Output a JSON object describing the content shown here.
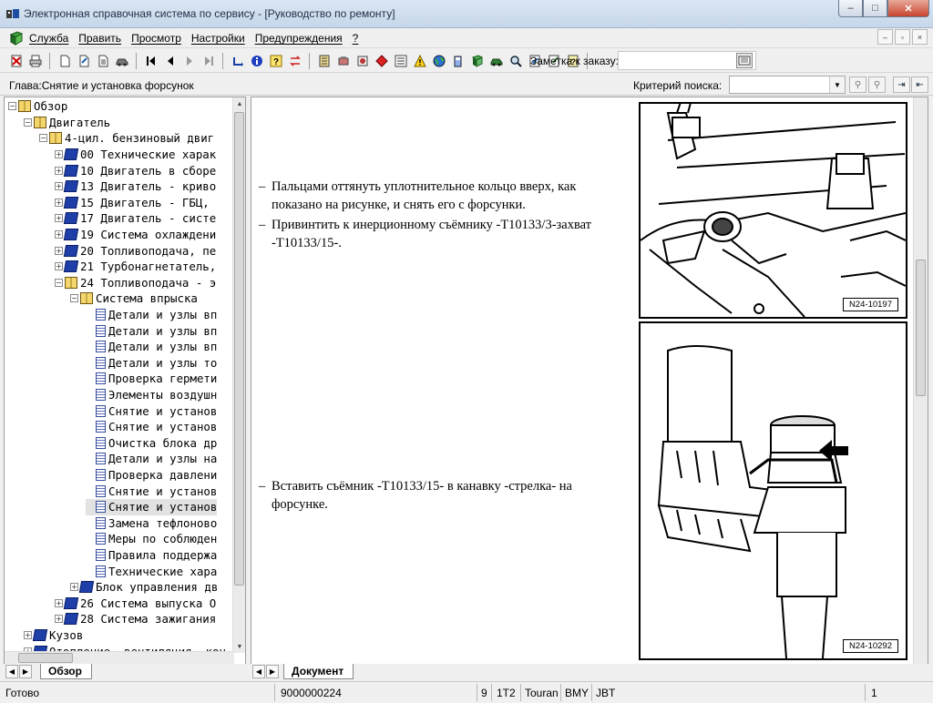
{
  "window": {
    "title": "Электронная справочная система по сервису - [Руководство по ремонту]",
    "minimize": "‒",
    "maximize": "□",
    "close": "✕"
  },
  "menu": {
    "items": [
      "Служба",
      "Править",
      "Просмотр",
      "Настройки",
      "Предупреждения",
      "?"
    ],
    "mdi": [
      "–",
      "▫",
      "×"
    ]
  },
  "toolbar": {
    "note_label": "Заметка к заказу:",
    "note_value": ""
  },
  "chapter": {
    "label": "Глава:Снятие и установка форсунок",
    "criteria_label": "Критерий поиска:",
    "criteria_value": ""
  },
  "tree": {
    "nodes": [
      {
        "level": 0,
        "expander": "−",
        "icon": "book-open",
        "text": "Обзор"
      },
      {
        "level": 1,
        "expander": "−",
        "icon": "book-open",
        "text": "Двигатель"
      },
      {
        "level": 2,
        "expander": "−",
        "icon": "book-open",
        "text": "4-цил. бензиновый двиг"
      },
      {
        "level": 3,
        "expander": "+",
        "icon": "book-closed",
        "text": "00 Технические харак"
      },
      {
        "level": 3,
        "expander": "+",
        "icon": "book-closed",
        "text": "10 Двигатель в сборе"
      },
      {
        "level": 3,
        "expander": "+",
        "icon": "book-closed",
        "text": "13 Двигатель - криво"
      },
      {
        "level": 3,
        "expander": "+",
        "icon": "book-closed",
        "text": "15 Двигатель - ГБЦ,"
      },
      {
        "level": 3,
        "expander": "+",
        "icon": "book-closed",
        "text": "17 Двигатель - систе"
      },
      {
        "level": 3,
        "expander": "+",
        "icon": "book-closed",
        "text": "19 Система охлаждени"
      },
      {
        "level": 3,
        "expander": "+",
        "icon": "book-closed",
        "text": "20 Топливоподача, пе"
      },
      {
        "level": 3,
        "expander": "+",
        "icon": "book-closed",
        "text": "21 Турбонагнетатель,"
      },
      {
        "level": 3,
        "expander": "−",
        "icon": "book-open",
        "text": "24 Топливоподача - э"
      },
      {
        "level": 4,
        "expander": "−",
        "icon": "book-open",
        "text": "Система впрыска"
      },
      {
        "level": 5,
        "expander": "",
        "icon": "doc",
        "text": "Детали и узлы вп"
      },
      {
        "level": 5,
        "expander": "",
        "icon": "doc",
        "text": "Детали и узлы вп"
      },
      {
        "level": 5,
        "expander": "",
        "icon": "doc",
        "text": "Детали и узлы вп"
      },
      {
        "level": 5,
        "expander": "",
        "icon": "doc",
        "text": "Детали и узлы то"
      },
      {
        "level": 5,
        "expander": "",
        "icon": "doc",
        "text": "Проверка гермети"
      },
      {
        "level": 5,
        "expander": "",
        "icon": "doc",
        "text": "Элементы воздушн"
      },
      {
        "level": 5,
        "expander": "",
        "icon": "doc",
        "text": "Снятие и установ"
      },
      {
        "level": 5,
        "expander": "",
        "icon": "doc",
        "text": "Снятие и установ"
      },
      {
        "level": 5,
        "expander": "",
        "icon": "doc",
        "text": "Очистка блока др"
      },
      {
        "level": 5,
        "expander": "",
        "icon": "doc",
        "text": "Детали и узлы на"
      },
      {
        "level": 5,
        "expander": "",
        "icon": "doc",
        "text": "Проверка давлени"
      },
      {
        "level": 5,
        "expander": "",
        "icon": "doc",
        "text": "Снятие и установ"
      },
      {
        "level": 5,
        "expander": "",
        "icon": "doc",
        "text": "Снятие и установ"
      },
      {
        "level": 5,
        "expander": "",
        "icon": "doc",
        "text": "Замена тефлоново"
      },
      {
        "level": 5,
        "expander": "",
        "icon": "doc",
        "text": "Меры по соблюден"
      },
      {
        "level": 5,
        "expander": "",
        "icon": "doc",
        "text": "Правила поддержа"
      },
      {
        "level": 5,
        "expander": "",
        "icon": "doc",
        "text": "Технические хара"
      },
      {
        "level": 4,
        "expander": "+",
        "icon": "book-closed",
        "text": "Блок управления дв"
      },
      {
        "level": 3,
        "expander": "+",
        "icon": "book-closed",
        "text": "26 Система выпуска О"
      },
      {
        "level": 3,
        "expander": "+",
        "icon": "book-closed",
        "text": "28 Система зажигания"
      },
      {
        "level": 1,
        "expander": "+",
        "icon": "book-closed",
        "text": "Кузов"
      },
      {
        "level": 1,
        "expander": "+",
        "icon": "book-closed",
        "text": "Отопление, вентиляция, кон"
      }
    ],
    "selected_index": 25
  },
  "document": {
    "paragraphs": [
      {
        "dash": "–",
        "lines": [
          "Пальцами оттянуть уплотнительное кольцо вверх, как",
          "показано на рисунке, и снять его с форсунки."
        ]
      },
      {
        "dash": "–",
        "lines": [
          "Привинтить к инерционному съёмнику -T10133/3-захват",
          "-T10133/15-."
        ]
      },
      {
        "dash": "–",
        "lines": [
          "Вставить съёмник -T10133/15- в канавку -стрелка- на",
          "форсунке."
        ]
      }
    ],
    "figures": [
      {
        "label": "N24-10197"
      },
      {
        "label": "N24-10292"
      }
    ]
  },
  "tabs": {
    "left_active": "Обзор",
    "right_active": "Документ"
  },
  "status": {
    "ready": "Готово",
    "order": "9000000224",
    "c1": "9",
    "c2": "1T2",
    "c3": "Touran",
    "c4": "BMY",
    "c5": "JBT",
    "page": "1"
  }
}
